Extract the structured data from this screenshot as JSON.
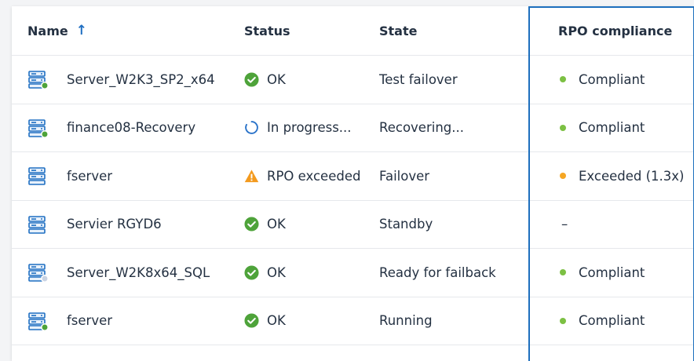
{
  "header": {
    "name": "Name",
    "name_sort_icon": "arrow-up-icon",
    "status": "Status",
    "state": "State",
    "rpo": "RPO compliance"
  },
  "colors": {
    "ok": "#4ea33a",
    "warning": "#f39a1e",
    "progress": "#2a73c9",
    "dot_green": "#7cc043",
    "dot_orange": "#f5a623",
    "highlight_border": "#1d6fbd"
  },
  "rows": [
    {
      "name": "Server_W2K3_SP2_x64",
      "badge": "green",
      "status_icon": "check-circle-icon",
      "status": "OK",
      "state": "Test failover",
      "rpo_dot": "green",
      "rpo": "Compliant"
    },
    {
      "name": "finance08-Recovery",
      "badge": "green",
      "status_icon": "spinner-icon",
      "status": "In progress...",
      "state": "Recovering...",
      "rpo_dot": "green",
      "rpo": "Compliant"
    },
    {
      "name": "fserver",
      "badge": "none",
      "status_icon": "warning-triangle-icon",
      "status": "RPO exceeded",
      "state": "Failover",
      "rpo_dot": "orange",
      "rpo": "Exceeded (1.3x)"
    },
    {
      "name": "Servier RGYD6",
      "badge": "none",
      "status_icon": "check-circle-icon",
      "status": "OK",
      "state": "Standby",
      "rpo_dot": "none",
      "rpo": "–"
    },
    {
      "name": "Server_W2K8x64_SQL",
      "badge": "grey",
      "status_icon": "check-circle-icon",
      "status": "OK",
      "state": "Ready for failback",
      "rpo_dot": "green",
      "rpo": "Compliant"
    },
    {
      "name": "fserver",
      "badge": "green",
      "status_icon": "check-circle-icon",
      "status": "OK",
      "state": "Running",
      "rpo_dot": "green",
      "rpo": "Compliant"
    }
  ]
}
